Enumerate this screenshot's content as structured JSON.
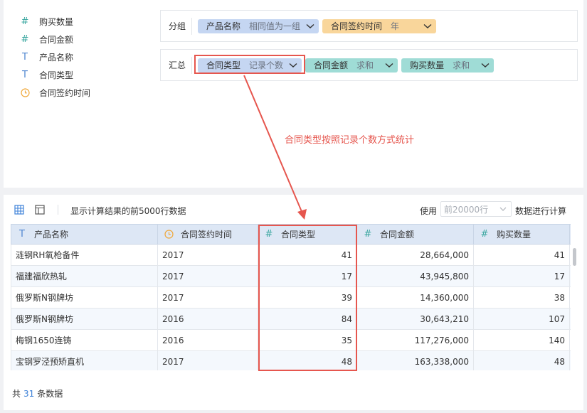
{
  "fields": [
    {
      "type": "number",
      "icon": "#",
      "name": "购买数量"
    },
    {
      "type": "number",
      "icon": "#",
      "name": "合同金额"
    },
    {
      "type": "text",
      "icon": "T",
      "name": "产品名称"
    },
    {
      "type": "text",
      "icon": "T",
      "name": "合同类型"
    },
    {
      "type": "date",
      "icon": "clock",
      "name": "合同签约时间"
    }
  ],
  "group": {
    "label": "分组",
    "pills": [
      {
        "name": "产品名称",
        "agg": "相同值为一组"
      },
      {
        "name": "合同签约时间",
        "agg": "年"
      }
    ]
  },
  "summary": {
    "label": "汇总",
    "pills": [
      {
        "name": "合同类型",
        "agg": "记录个数"
      },
      {
        "name": "合同金额",
        "agg": "求和"
      },
      {
        "name": "购买数量",
        "agg": "求和"
      }
    ]
  },
  "annotation": "合同类型按照记录个数方式统计",
  "toolbar": {
    "info": "显示计算结果的前5000行数据",
    "use_label": "使用",
    "rows_select": "前20000行",
    "after_label": "数据进行计算"
  },
  "table": {
    "columns": [
      {
        "icon": "T",
        "name": "产品名称"
      },
      {
        "icon": "clock",
        "name": "合同签约时间"
      },
      {
        "icon": "#",
        "name": "合同类型"
      },
      {
        "icon": "#",
        "name": "合同金额"
      },
      {
        "icon": "#",
        "name": "购买数量"
      }
    ],
    "rows": [
      [
        "涟钢RH氧枪备件",
        "2017",
        "41",
        "28,664,000",
        "41"
      ],
      [
        "福建福欣热轧",
        "2017",
        "17",
        "43,945,800",
        "17"
      ],
      [
        "俄罗斯N钢牌坊",
        "2017",
        "39",
        "14,360,000",
        "38"
      ],
      [
        "俄罗斯N钢牌坊",
        "2016",
        "84",
        "30,643,210",
        "107"
      ],
      [
        "梅钢1650连铸",
        "2016",
        "35",
        "117,276,000",
        "140"
      ],
      [
        "宝钢罗泾预矫直机",
        "2017",
        "48",
        "163,338,000",
        "48"
      ]
    ]
  },
  "footer": {
    "prefix": "共",
    "count": "31",
    "suffix": "条数据"
  },
  "colors": {
    "accent": "#3e82d8",
    "highlight": "#e6564e",
    "teal": "#9fdcd6",
    "blue": "#c5d6f2",
    "orange": "#f9d69b"
  }
}
